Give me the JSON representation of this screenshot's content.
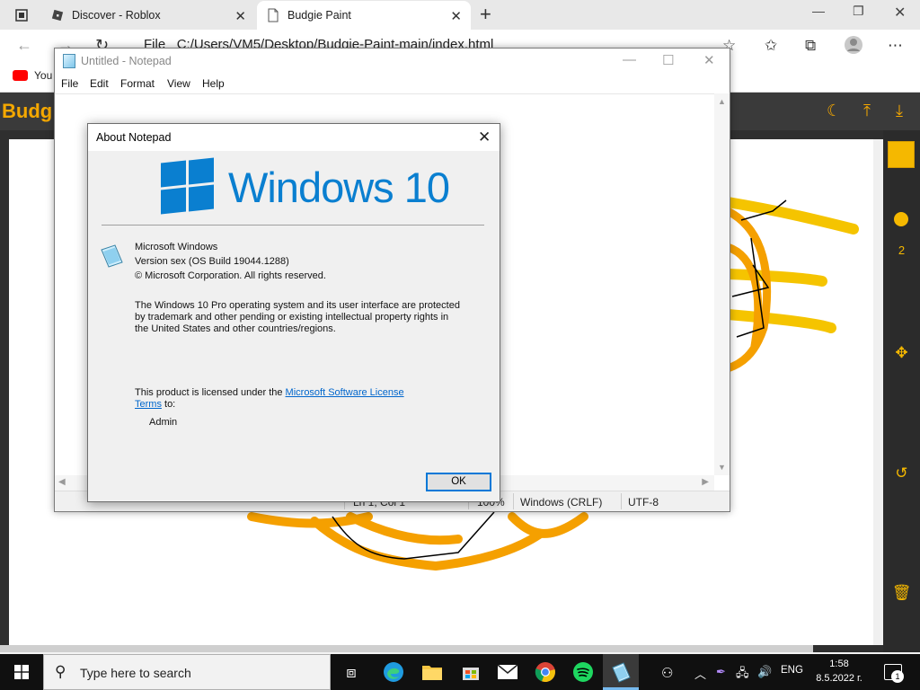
{
  "browser": {
    "tabs": [
      {
        "title": "Discover - Roblox"
      },
      {
        "title": "Budgie Paint"
      }
    ],
    "new_tab": "+",
    "address": "C:/Users/VM5/Desktop/Budgie-Paint-main/index.html",
    "address_scheme": "File",
    "bookmark_partial": "You"
  },
  "paint": {
    "title_partial": "Budg",
    "brush_size": "2",
    "accent_color": "#f5a800"
  },
  "notepad": {
    "title": "Untitled - Notepad",
    "menu": [
      "File",
      "Edit",
      "Format",
      "View",
      "Help"
    ],
    "status": {
      "position": "Ln 1, Col 1",
      "zoom": "100%",
      "line_ending": "Windows (CRLF)",
      "encoding": "UTF-8"
    }
  },
  "about": {
    "title": "About Notepad",
    "logo_text": "Windows 10",
    "product": "Microsoft Windows",
    "version": "Version sex (OS Build 19044.1288)",
    "copyright": "© Microsoft Corporation. All rights reserved.",
    "legal_1": "The Windows 10 Pro operating system and its user interface are protected",
    "legal_2": "by trademark and other pending or existing intellectual property rights in",
    "legal_3": "the United States and other countries/regions.",
    "license_prefix": "This product is licensed under the ",
    "license_link_1": "Microsoft Software License",
    "license_link_2": "Terms",
    "license_suffix": " to:",
    "licensee": "Admin",
    "ok_label": "OK"
  },
  "taskbar": {
    "search_placeholder": "Type here to search",
    "language": "ENG",
    "time": "1:58",
    "date": "8.5.2022 г.",
    "notification_count": "1"
  }
}
